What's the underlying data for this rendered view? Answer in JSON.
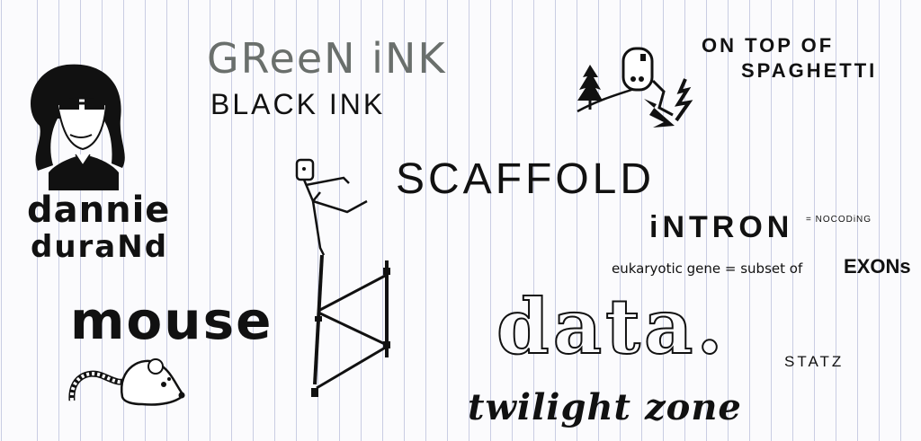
{
  "words": {
    "green_ink": "GReeN iNK",
    "black_ink": "BLACK INK",
    "spaghetti_line1": "ON TOP OF",
    "spaghetti_line2": "SPAGHETTI",
    "scaffold": "SCAFFOLD",
    "intron": "iNTRON",
    "nocoding": "= NOCODiNG",
    "eukaryotic": "eukaryotic gene = subset of",
    "exons": "EXONs",
    "name_line1": "dannie",
    "name_line2": "duraNd",
    "mouse": "mouse",
    "data": "data.",
    "statz": "STATZ",
    "twilight": "twilight zone"
  },
  "colors": {
    "ink": "#111111",
    "green_ink": "#6a6f6c",
    "paper": "#fbfbfd",
    "rule_line": "#c9cde3"
  }
}
